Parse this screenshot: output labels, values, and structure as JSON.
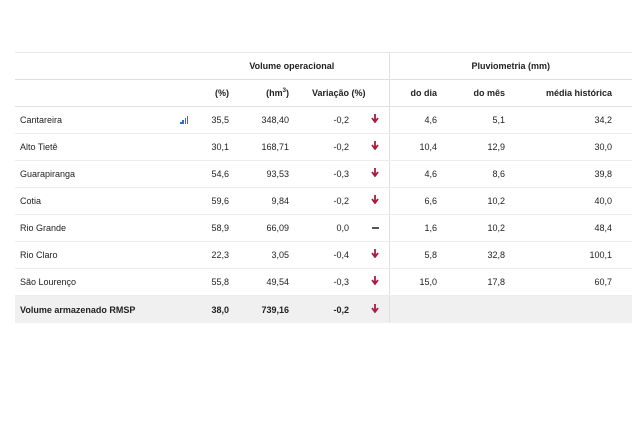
{
  "header": {
    "volume_group": "Volume operacional",
    "pluvio_group": "Pluviometria (mm)",
    "col_pct": "(%)",
    "col_hm3": "(hm³)",
    "col_variation": "Variação (%)",
    "col_day": "do dia",
    "col_month": "do mês",
    "col_hist": "média histórica"
  },
  "rows": [
    {
      "name": "Cantareira",
      "pct": "35,5",
      "hm3": "348,40",
      "var": "-0,2",
      "trend": "down",
      "day": "4,6",
      "month": "5,1",
      "hist": "34,2",
      "chart_icon": "signal-bars-icon"
    },
    {
      "name": "Alto Tietê",
      "pct": "30,1",
      "hm3": "168,71",
      "var": "-0,2",
      "trend": "down",
      "day": "10,4",
      "month": "12,9",
      "hist": "30,0"
    },
    {
      "name": "Guarapiranga",
      "pct": "54,6",
      "hm3": "93,53",
      "var": "-0,3",
      "trend": "down",
      "day": "4,6",
      "month": "8,6",
      "hist": "39,8"
    },
    {
      "name": "Cotia",
      "pct": "59,6",
      "hm3": "9,84",
      "var": "-0,2",
      "trend": "down",
      "day": "6,6",
      "month": "10,2",
      "hist": "40,0"
    },
    {
      "name": "Rio Grande",
      "pct": "58,9",
      "hm3": "66,09",
      "var": "0,0",
      "trend": "flat",
      "day": "1,6",
      "month": "10,2",
      "hist": "48,4"
    },
    {
      "name": "Rio Claro",
      "pct": "22,3",
      "hm3": "3,05",
      "var": "-0,4",
      "trend": "down",
      "day": "5,8",
      "month": "32,8",
      "hist": "100,1"
    },
    {
      "name": "São Lourenço",
      "pct": "55,8",
      "hm3": "49,54",
      "var": "-0,3",
      "trend": "down",
      "day": "15,0",
      "month": "17,8",
      "hist": "60,7"
    }
  ],
  "total": {
    "name": "Volume armazenado RMSP",
    "pct": "38,0",
    "hm3": "739,16",
    "var": "-0,2",
    "trend": "down"
  },
  "colors": {
    "arrow": "#a51d3f",
    "icon": "#2a6fd1",
    "total_bg": "#f0f0f0"
  }
}
